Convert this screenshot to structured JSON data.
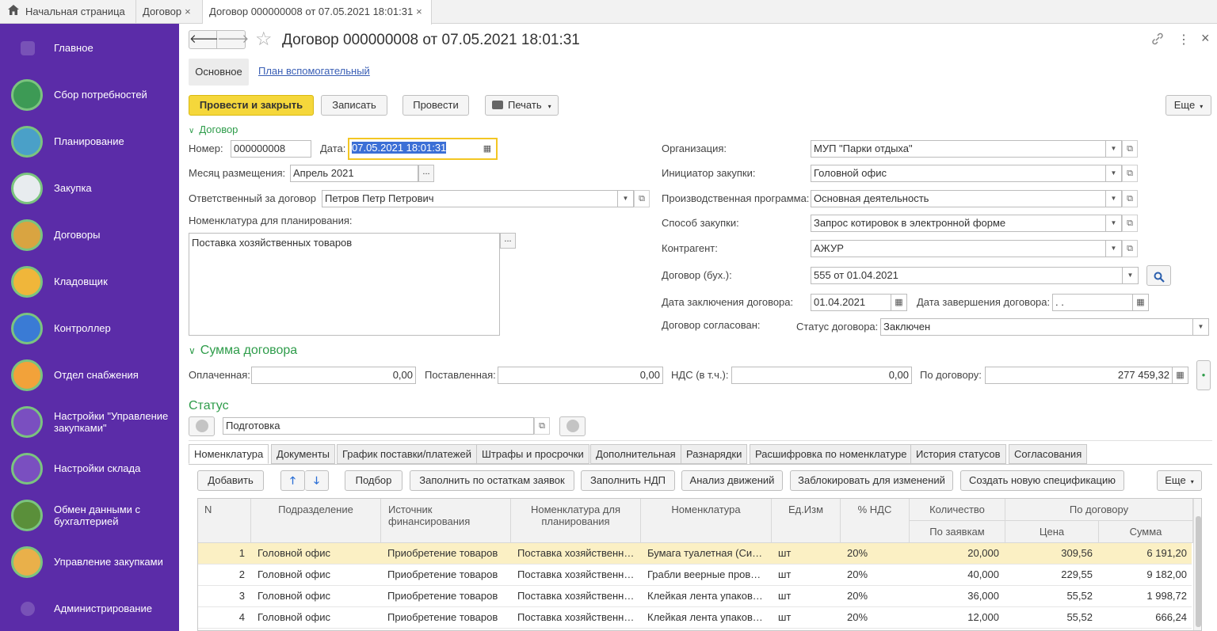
{
  "topbar": {
    "home_label": "Начальная страница",
    "tab1_label": "Договор",
    "tab2_label": "Договор 000000008 от 07.05.2021 18:01:31",
    "close": "×"
  },
  "sidebar": {
    "items": [
      {
        "label": "Главное"
      },
      {
        "label": "Сбор потребностей"
      },
      {
        "label": "Планирование"
      },
      {
        "label": "Закупка"
      },
      {
        "label": "Договоры"
      },
      {
        "label": "Кладовщик"
      },
      {
        "label": "Контроллер"
      },
      {
        "label": "Отдел снабжения"
      },
      {
        "label": "Настройки \"Управление закупками\""
      },
      {
        "label": "Настройки склада"
      },
      {
        "label": "Обмен данными с бухгалтерией"
      },
      {
        "label": "Управление закупками"
      },
      {
        "label": "Администрирование"
      }
    ]
  },
  "header": {
    "title": "Договор 000000008 от 07.05.2021 18:01:31",
    "back": "🡐",
    "forward": "🡒",
    "star": "☆",
    "link": "🔗",
    "menu": "⋮",
    "close": "×"
  },
  "subtabs": {
    "main": "Основное",
    "plan": "План вспомогательный"
  },
  "toolbar": {
    "post_close": "Провести и закрыть",
    "save": "Записать",
    "post": "Провести",
    "print": "Печать",
    "more": "Еще"
  },
  "contract": {
    "section": "Договор",
    "number_label": "Номер:",
    "number": "000000008",
    "date_label": "Дата:",
    "date": "07.05.2021 18:01:31",
    "month_label": "Месяц размещения:",
    "month": "Апрель 2021",
    "responsible_label": "Ответственный за договор",
    "responsible": "Петров Петр Петрович",
    "nomenclature_label": "Номенклатура для планирования:",
    "nomenclature": "Поставка хозяйственных товаров",
    "org_label": "Организация:",
    "org": "МУП \"Парки отдыха\"",
    "initiator_label": "Инициатор закупки:",
    "initiator": "Головной офис",
    "program_label": "Производственная программа:",
    "program": "Основная деятельность",
    "method_label": "Способ закупки:",
    "method": "Запрос котировок в электронной форме",
    "counterparty_label": "Контрагент:",
    "counterparty": "АЖУР",
    "acc_contract_label": "Договор (бух.):",
    "acc_contract": "555 от 01.04.2021",
    "sign_date_label": "Дата заключения договора:",
    "sign_date": "01.04.2021",
    "end_date_label": "Дата завершения договора:",
    "end_date": " .  .",
    "agreed_label": "Договор согласован:",
    "status_label": "Статус договора:",
    "status": "Заключен",
    "ellipsis": "..."
  },
  "sums": {
    "section": "Сумма договора",
    "paid_label": "Оплаченная:",
    "paid": "0,00",
    "delivered_label": "Поставленная:",
    "delivered": "0,00",
    "vat_label": "НДС (в т.ч.):",
    "vat": "0,00",
    "total_label": "По договору:",
    "total": "277 459,32"
  },
  "status_block": {
    "section": "Статус",
    "value": "Подготовка"
  },
  "tabs": [
    "Номенклатура",
    "Документы",
    "График поставки/платежей",
    "Штрафы и просрочки",
    "Дополнительная",
    "Разнарядки",
    "Расшифровка по номенклатуре",
    "История статусов",
    "Согласования"
  ],
  "tab_toolbar": {
    "add": "Добавить",
    "select": "Подбор",
    "fill_remains": "Заполнить по остаткам заявок",
    "fill_vat": "Заполнить НДП",
    "analysis": "Анализ движений",
    "block": "Заблокировать для изменений",
    "new_spec": "Создать новую спецификацию",
    "more": "Еще"
  },
  "table": {
    "headers": {
      "n": "N",
      "dept": "Подразделение",
      "source": "Источник финансирования",
      "nomplan": "Номенклатура для планирования",
      "nom": "Номенклатура",
      "unit": "Ед.Изм",
      "vat": "% НДС",
      "qty": "Количество",
      "qty_sub": "По заявкам",
      "contract": "По договору",
      "price": "Цена",
      "sum": "Сумма"
    },
    "rows": [
      {
        "n": "1",
        "dept": "Головной офис",
        "source": "Приобретение товаров",
        "nomplan": "Поставка хозяйственных товаров",
        "nom": "Бумага туалетная (Система)",
        "unit": "шт",
        "vat": "20%",
        "qty": "20,000",
        "price": "309,56",
        "sum": "6 191,20"
      },
      {
        "n": "2",
        "dept": "Головной офис",
        "source": "Приобретение товаров",
        "nomplan": "Поставка хозяйственных товаров",
        "nom": "Грабли веерные проволочные",
        "unit": "шт",
        "vat": "20%",
        "qty": "40,000",
        "price": "229,55",
        "sum": "9 182,00"
      },
      {
        "n": "3",
        "dept": "Головной офис",
        "source": "Приобретение товаров",
        "nomplan": "Поставка хозяйственных товаров",
        "nom": "Клейкая лента упаковочная",
        "unit": "шт",
        "vat": "20%",
        "qty": "36,000",
        "price": "55,52",
        "sum": "1 998,72"
      },
      {
        "n": "4",
        "dept": "Головной офис",
        "source": "Приобретение товаров",
        "nomplan": "Поставка хозяйственных товаров",
        "nom": "Клейкая лента упаковочная",
        "unit": "шт",
        "vat": "20%",
        "qty": "12,000",
        "price": "55,52",
        "sum": "666,24"
      }
    ]
  },
  "colors": {
    "sidebar": "#5b2ca8",
    "accent": "#2e9c4a",
    "primary_button": "#f5d73b",
    "selected_row": "#fbf0c4"
  }
}
